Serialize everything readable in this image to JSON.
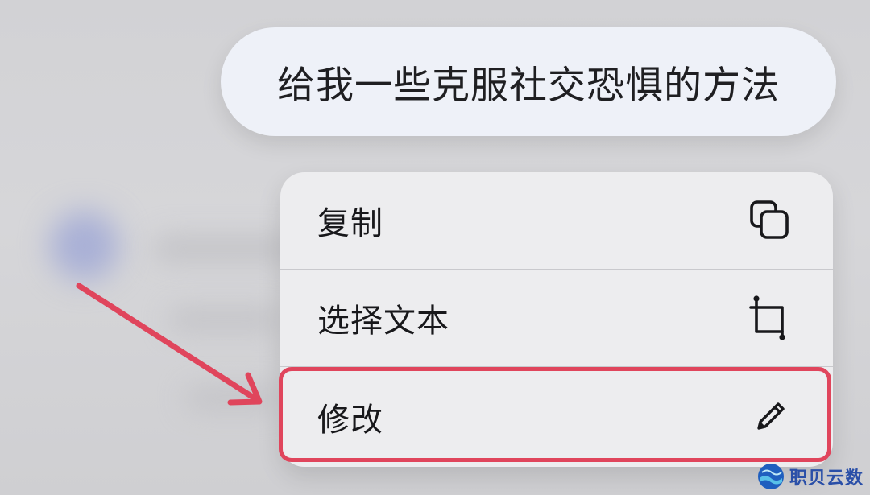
{
  "message": {
    "text": "给我一些克服社交恐惧的方法"
  },
  "context_menu": {
    "items": [
      {
        "label": "复制",
        "icon": "copy-icon"
      },
      {
        "label": "选择文本",
        "icon": "crop-icon"
      },
      {
        "label": "修改",
        "icon": "pencil-icon"
      }
    ],
    "highlighted_item": "修改"
  },
  "annotation": {
    "arrow_color": "#e0455c",
    "highlight_color": "#e0455c"
  },
  "watermark": {
    "text": "职贝云数"
  }
}
